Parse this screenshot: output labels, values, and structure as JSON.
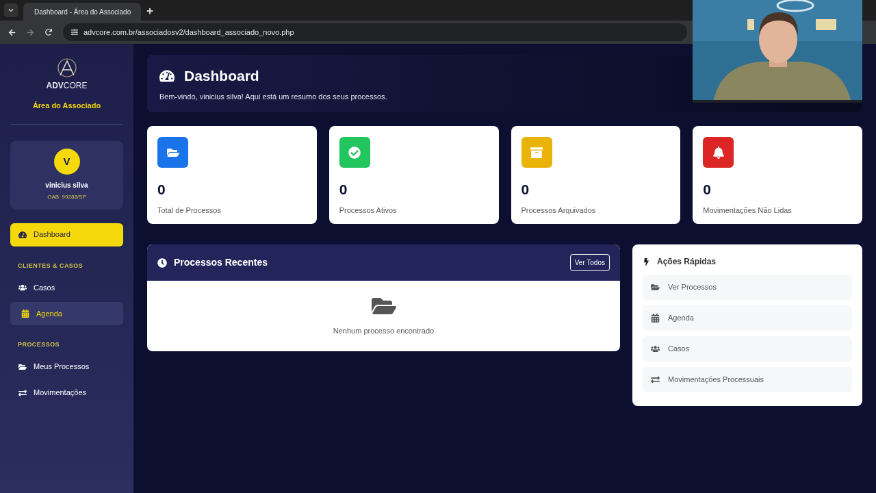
{
  "browser": {
    "tab_title": "Dashboard - Área do Associado",
    "url": "advcore.com.br/associadosv2/dashboard_associado_novo.php"
  },
  "sidebar": {
    "brand_bold": "ADV",
    "brand_rest": "CORE",
    "subtitle": "Área do Associado",
    "user": {
      "initial": "V",
      "name": "vinicius silva",
      "oab": "OAB: 99288/SP"
    },
    "nav": [
      {
        "kind": "item",
        "label": "Dashboard",
        "selected": true,
        "hovered": false
      },
      {
        "kind": "section",
        "label": "CLIENTES & CASOS"
      },
      {
        "kind": "item",
        "label": "Casos",
        "selected": false,
        "hovered": false
      },
      {
        "kind": "item",
        "label": "Agenda",
        "selected": false,
        "hovered": true
      },
      {
        "kind": "section",
        "label": "PROCESSOS"
      },
      {
        "kind": "item",
        "label": "Meus Processos",
        "selected": false,
        "hovered": false
      },
      {
        "kind": "item",
        "label": "Movimentações",
        "selected": false,
        "hovered": false
      }
    ]
  },
  "header": {
    "title": "Dashboard",
    "subtitle": "Bem-vindo, vinicius silva! Aqui está um resumo dos seus processos."
  },
  "stats": [
    {
      "value": "0",
      "label": "Total de Processos",
      "color": "#1a73e8"
    },
    {
      "value": "0",
      "label": "Processos Ativos",
      "color": "#22c55e"
    },
    {
      "value": "0",
      "label": "Processos Arquivados",
      "color": "#eab308"
    },
    {
      "value": "0",
      "label": "Movimentações Não Lidas",
      "color": "#dc2626"
    }
  ],
  "recent": {
    "title": "Processos Recentes",
    "button": "Ver Todos",
    "empty": "Nenhum processo encontrado"
  },
  "quick_actions": {
    "title": "Ações Rápidas",
    "items": [
      "Ver Processos",
      "Agenda",
      "Casos",
      "Movimentações Processuais"
    ]
  }
}
